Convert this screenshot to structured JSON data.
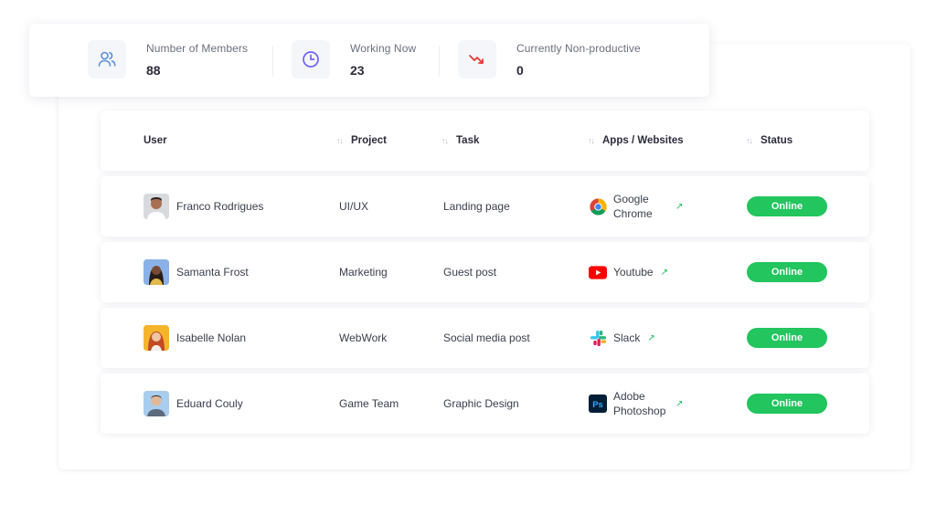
{
  "stats": [
    {
      "label": "Number of Members",
      "value": "88",
      "icon": "users-icon"
    },
    {
      "label": "Working Now",
      "value": "23",
      "icon": "clock-icon"
    },
    {
      "label": "Currently Non-productive",
      "value": "0",
      "icon": "trend-down-icon"
    }
  ],
  "table": {
    "headers": {
      "user": "User",
      "project": "Project",
      "task": "Task",
      "apps": "Apps / Websites",
      "status": "Status"
    },
    "rows": [
      {
        "user": "Franco Rodrigues",
        "project": "UI/UX",
        "task": "Landing page",
        "app": "Google Chrome",
        "app_icon": "chrome-icon",
        "status": "Online"
      },
      {
        "user": "Samanta Frost",
        "project": "Marketing",
        "task": "Guest post",
        "app": "Youtube",
        "app_icon": "youtube-icon",
        "status": "Online"
      },
      {
        "user": "Isabelle Nolan",
        "project": "WebWork",
        "task": "Social media post",
        "app": "Slack",
        "app_icon": "slack-icon",
        "status": "Online"
      },
      {
        "user": "Eduard Couly",
        "project": "Game Team",
        "task": "Graphic Design",
        "app": "Adobe Photoshop",
        "app_icon": "photoshop-icon",
        "status": "Online"
      }
    ]
  },
  "colors": {
    "online": "#22c55e",
    "accent": "#6c63ff",
    "trend_down": "#e53935"
  }
}
